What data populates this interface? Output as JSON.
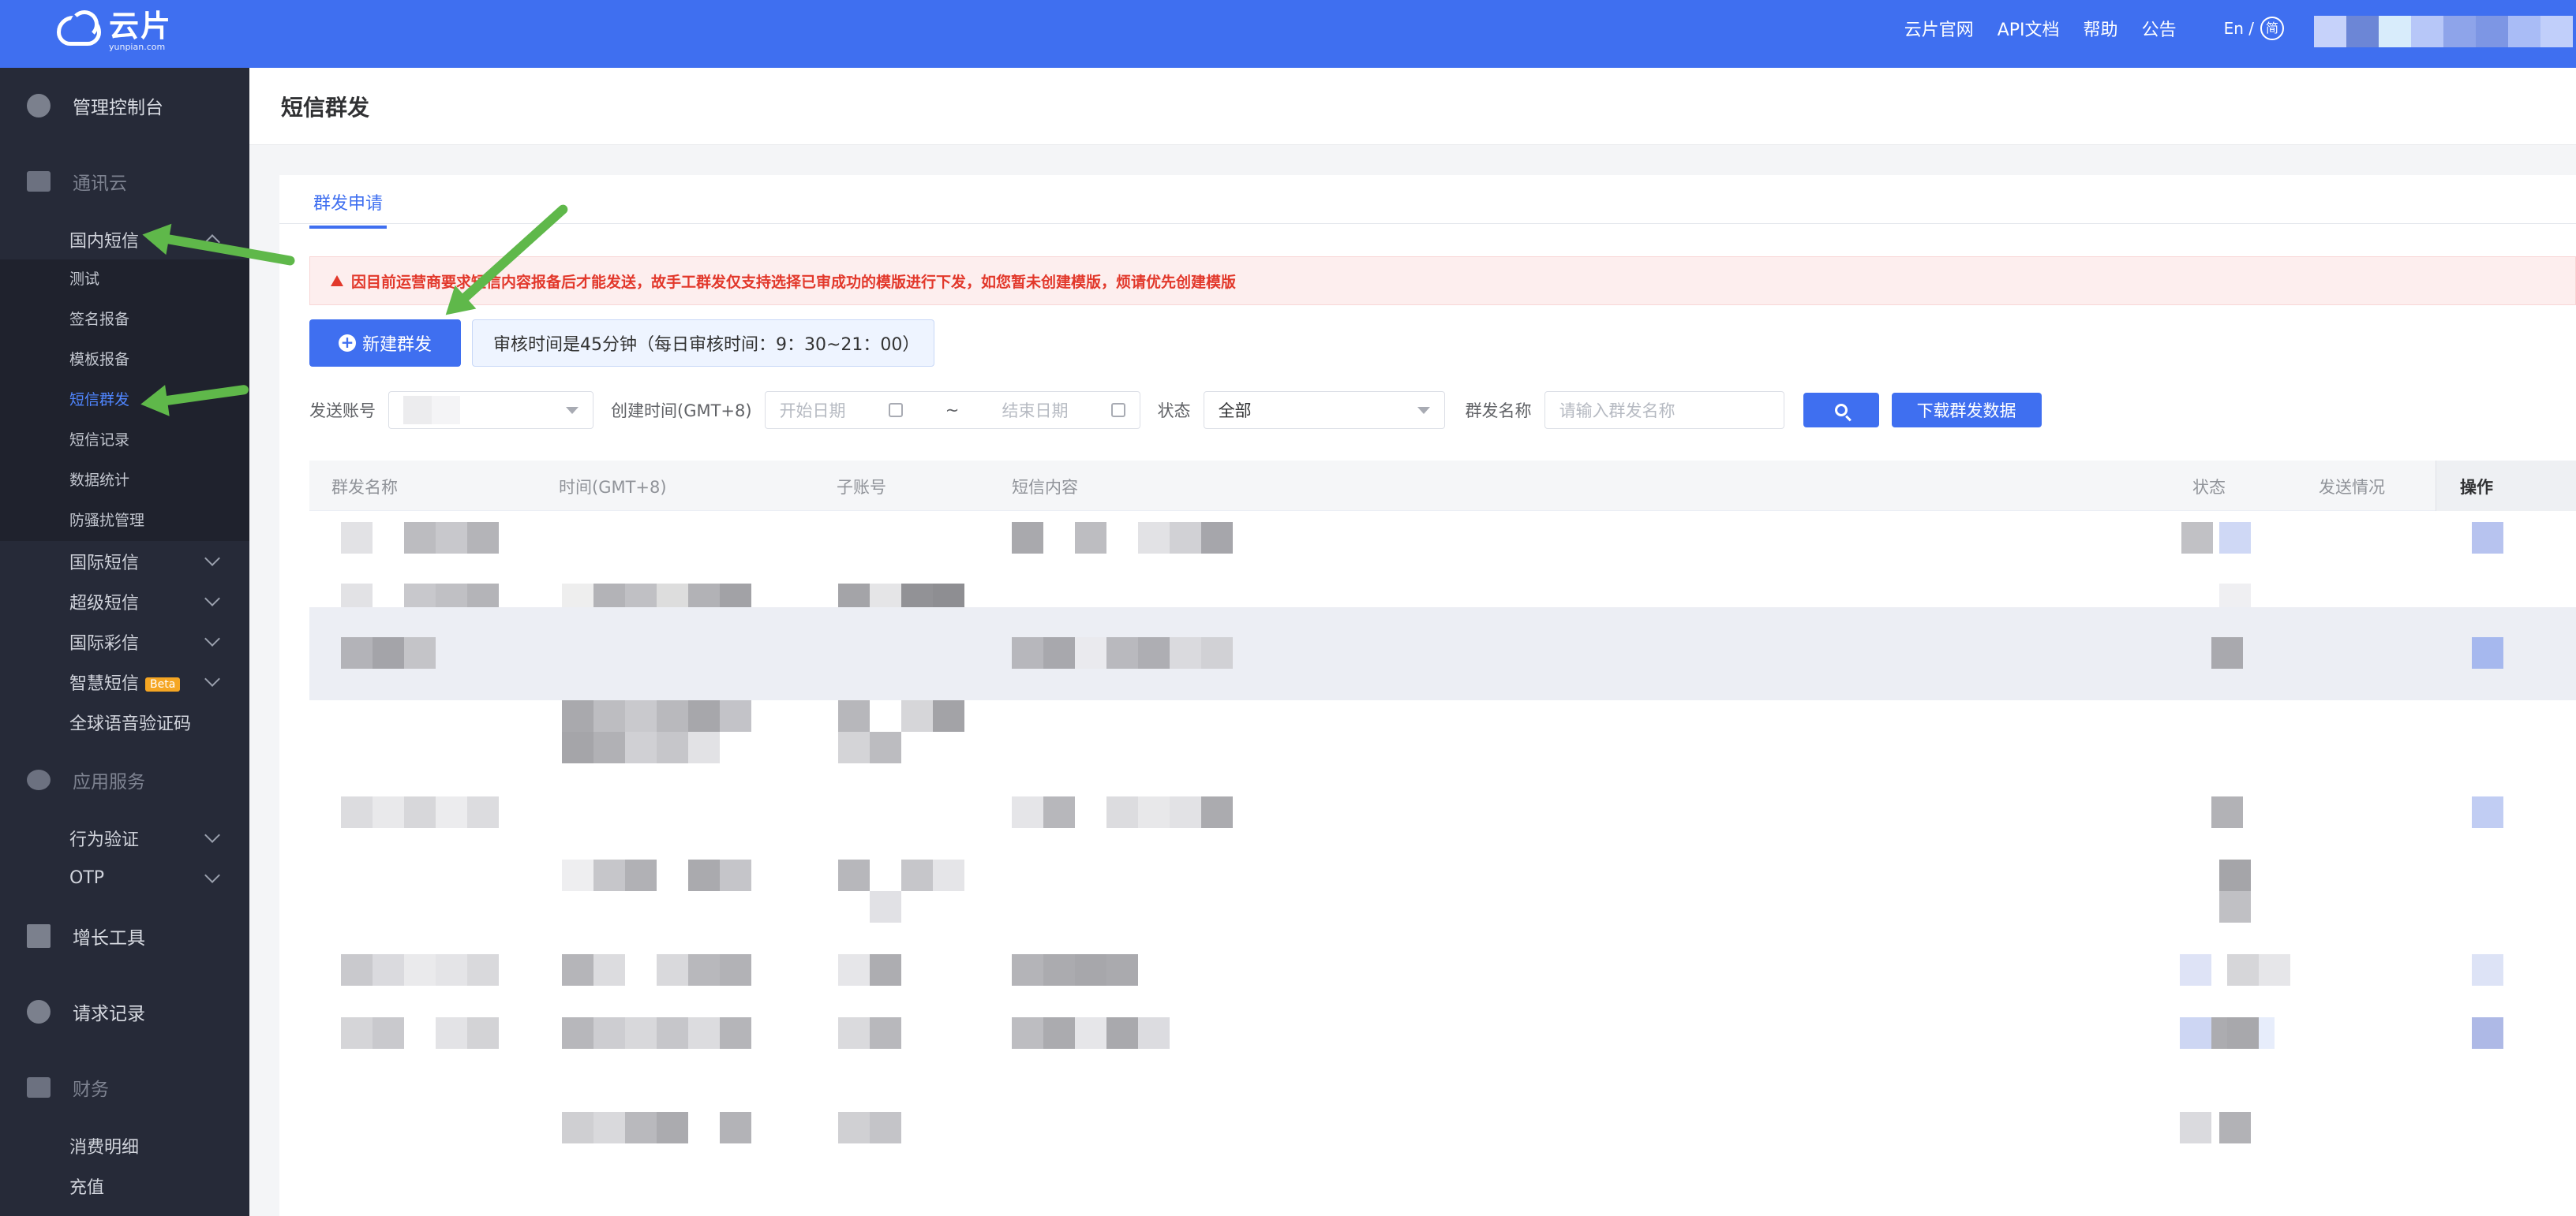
{
  "header": {
    "logo_name": "云片",
    "logo_sub": "yunpian.com",
    "nav": [
      "云片官网",
      "API文档",
      "帮助",
      "公告"
    ],
    "lang_en": "En /",
    "lang_zh": "简"
  },
  "sidebar": {
    "dashboard": "管理控制台",
    "section_comm": "通讯云",
    "domestic_sms": "国内短信",
    "domestic_items": [
      "测试",
      "签名报备",
      "模板报备",
      "短信群发",
      "短信记录",
      "数据统计",
      "防骚扰管理"
    ],
    "groups": [
      "国际短信",
      "超级短信",
      "国际彩信",
      "智慧短信"
    ],
    "beta": "Beta",
    "voice": "全球语音验证码",
    "section_app": "应用服务",
    "app_items": [
      "行为验证",
      "OTP"
    ],
    "growth": "增长工具",
    "requests": "请求记录",
    "section_finance": "财务",
    "finance_items": [
      "消费明细",
      "充值"
    ]
  },
  "page": {
    "title": "短信群发",
    "tab": "群发申请",
    "alert": "因目前运营商要求短信内容报备后才能发送，故手工群发仅支持选择已审成功的模版进行下发，如您暂未创建模版，烦请优先创建模版",
    "new_button": "新建群发",
    "notice": "审核时间是45分钟（每日审核时间：9：30~21：00）"
  },
  "filters": {
    "account_label": "发送账号",
    "created_label": "创建时间(GMT+8)",
    "start_placeholder": "开始日期",
    "range_sep": "~",
    "end_placeholder": "结束日期",
    "status_label": "状态",
    "status_value": "全部",
    "name_label": "群发名称",
    "name_placeholder": "请输入群发名称",
    "download_button": "下载群发数据"
  },
  "table": {
    "columns": [
      "群发名称",
      "时间(GMT+8)",
      "子账号",
      "短信内容",
      "状态",
      "发送情况",
      "操作"
    ]
  },
  "colors": {
    "brand": "#3f6ff0",
    "sidebar": "#262a38",
    "alert_text": "#e2382b",
    "arrow": "#5fb84a"
  }
}
